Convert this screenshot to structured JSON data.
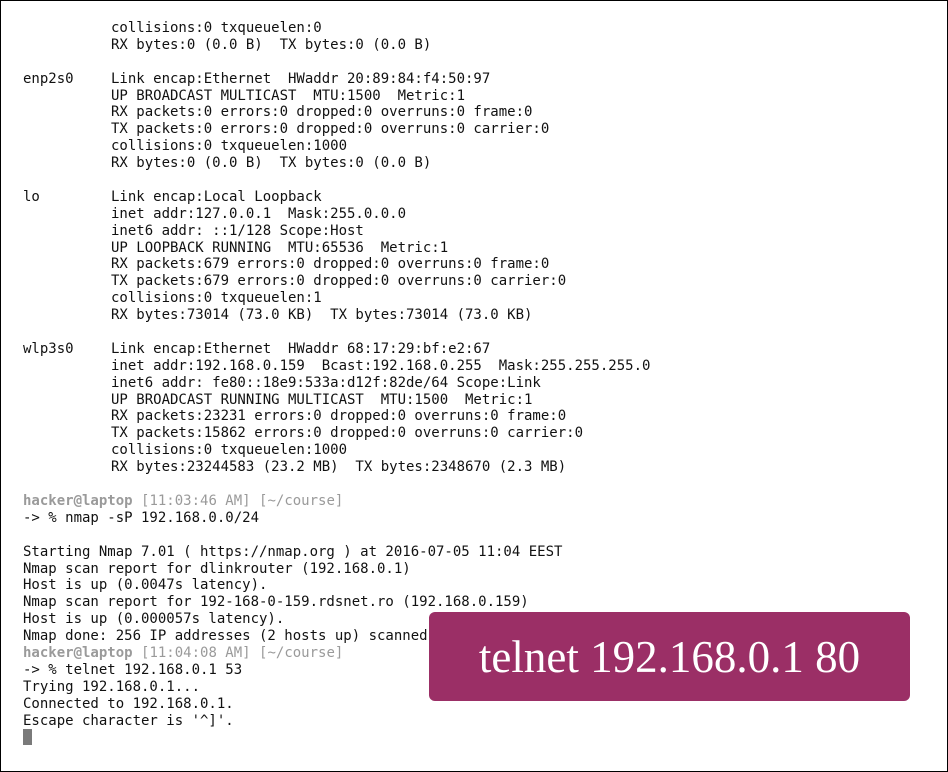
{
  "terminal": {
    "top": {
      "line1": "collisions:0 txqueuelen:0",
      "line2": "RX bytes:0 (0.0 B)  TX bytes:0 (0.0 B)"
    },
    "interfaces": [
      {
        "name": "enp2s0",
        "lines": [
          "Link encap:Ethernet  HWaddr 20:89:84:f4:50:97",
          "UP BROADCAST MULTICAST  MTU:1500  Metric:1",
          "RX packets:0 errors:0 dropped:0 overruns:0 frame:0",
          "TX packets:0 errors:0 dropped:0 overruns:0 carrier:0",
          "collisions:0 txqueuelen:1000",
          "RX bytes:0 (0.0 B)  TX bytes:0 (0.0 B)"
        ]
      },
      {
        "name": "lo",
        "lines": [
          "Link encap:Local Loopback",
          "inet addr:127.0.0.1  Mask:255.0.0.0",
          "inet6 addr: ::1/128 Scope:Host",
          "UP LOOPBACK RUNNING  MTU:65536  Metric:1",
          "RX packets:679 errors:0 dropped:0 overruns:0 frame:0",
          "TX packets:679 errors:0 dropped:0 overruns:0 carrier:0",
          "collisions:0 txqueuelen:1",
          "RX bytes:73014 (73.0 KB)  TX bytes:73014 (73.0 KB)"
        ]
      },
      {
        "name": "wlp3s0",
        "lines": [
          "Link encap:Ethernet  HWaddr 68:17:29:bf:e2:67",
          "inet addr:192.168.0.159  Bcast:192.168.0.255  Mask:255.255.255.0",
          "inet6 addr: fe80::18e9:533a:d12f:82de/64 Scope:Link",
          "UP BROADCAST RUNNING MULTICAST  MTU:1500  Metric:1",
          "RX packets:23231 errors:0 dropped:0 overruns:0 frame:0",
          "TX packets:15862 errors:0 dropped:0 overruns:0 carrier:0",
          "collisions:0 txqueuelen:1000",
          "RX bytes:23244583 (23.2 MB)  TX bytes:2348670 (2.3 MB)"
        ]
      }
    ],
    "prompt1": {
      "user": "hacker@laptop",
      "time": "[11:03:46 AM]",
      "dir": "[~/course]",
      "command": "-> % nmap -sP 192.168.0.0/24"
    },
    "nmap_output": [
      "Starting Nmap 7.01 ( https://nmap.org ) at 2016-07-05 11:04 EEST",
      "Nmap scan report for dlinkrouter (192.168.0.1)",
      "Host is up (0.0047s latency).",
      "Nmap scan report for 192-168-0-159.rdsnet.ro (192.168.0.159)",
      "Host is up (0.000057s latency).",
      "Nmap done: 256 IP addresses (2 hosts up) scanned in 3.03 seconds"
    ],
    "prompt2": {
      "user": "hacker@laptop",
      "time": "[11:04:08 AM]",
      "dir": "[~/course]",
      "command": "-> % telnet 192.168.0.1 53"
    },
    "telnet_output": [
      "Trying 192.168.0.1...",
      "Connected to 192.168.0.1.",
      "Escape character is '^]'."
    ]
  },
  "overlay": {
    "text": "telnet 192.168.0.1 80",
    "color": "#9b2f66"
  }
}
